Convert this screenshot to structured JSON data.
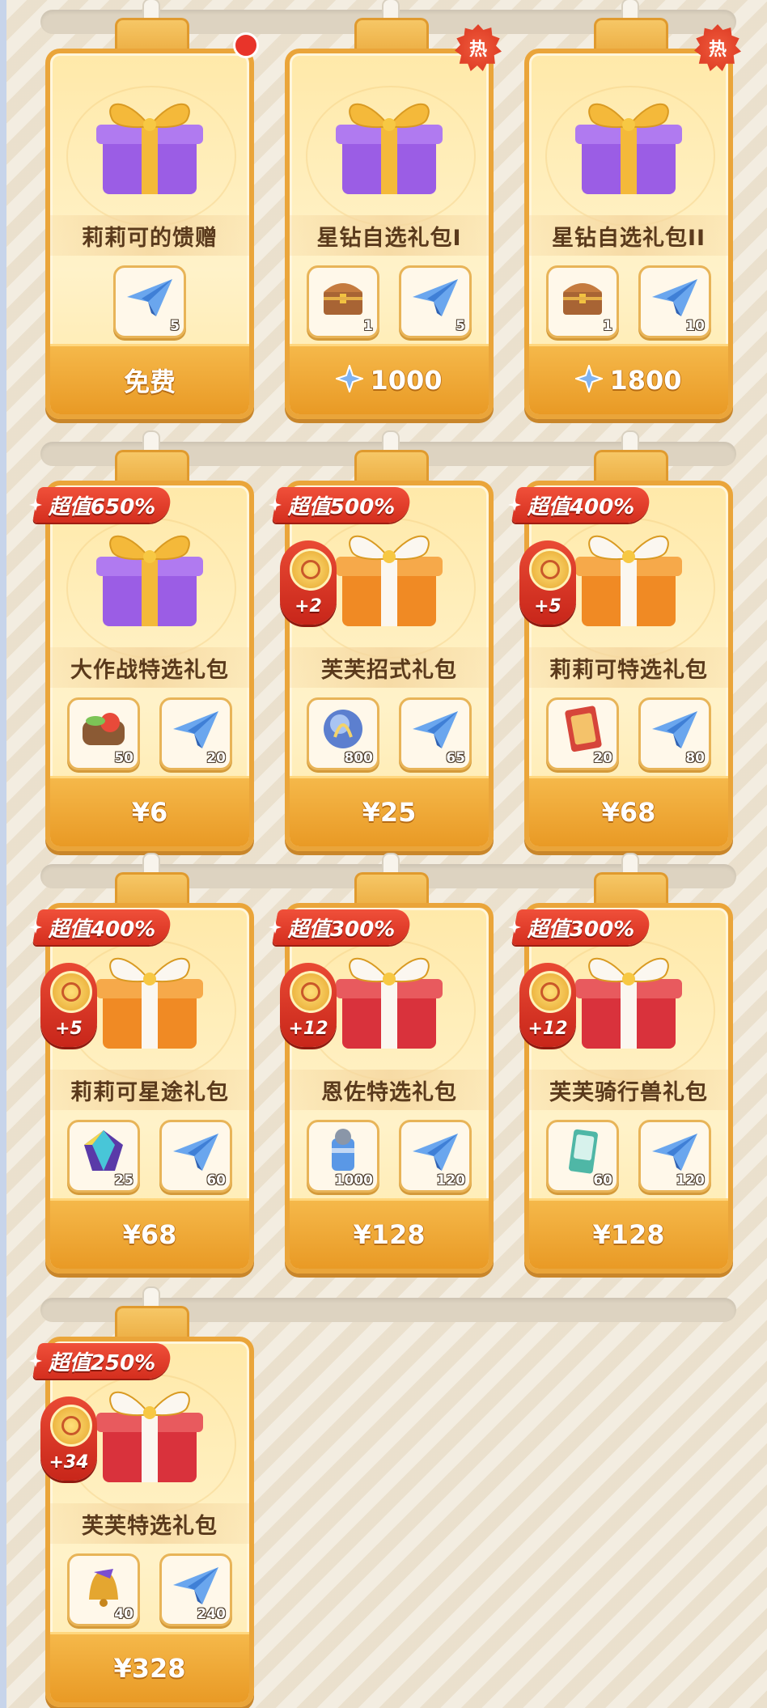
{
  "cards": [
    {
      "title": "莉莉可的馈赠",
      "gift": "purple-gift",
      "price": "免费",
      "currency": "",
      "hot": "",
      "red_dot": true,
      "value": "",
      "bonus": "",
      "items": [
        {
          "icon": "paper-plane-icon",
          "qty": "5"
        }
      ]
    },
    {
      "title": "星钻自选礼包I",
      "gift": "purple-gift",
      "price": "1000",
      "currency": "star-diamond-icon",
      "hot": "热",
      "red_dot": false,
      "value": "",
      "bonus": "",
      "items": [
        {
          "icon": "treasure-chest-icon",
          "qty": "1"
        },
        {
          "icon": "paper-plane-icon",
          "qty": "5"
        }
      ]
    },
    {
      "title": "星钻自选礼包II",
      "gift": "purple-gift",
      "price": "1800",
      "currency": "star-diamond-icon",
      "hot": "热",
      "red_dot": false,
      "value": "",
      "bonus": "",
      "items": [
        {
          "icon": "treasure-chest-icon",
          "qty": "1"
        },
        {
          "icon": "paper-plane-icon",
          "qty": "10"
        }
      ]
    },
    {
      "title": "大作战特选礼包",
      "gift": "purple-gift",
      "price": "¥6",
      "currency": "",
      "hot": "",
      "red_dot": false,
      "value": "超值650%",
      "bonus": "",
      "items": [
        {
          "icon": "food-box-icon",
          "qty": "50"
        },
        {
          "icon": "paper-plane-icon",
          "qty": "20"
        }
      ]
    },
    {
      "title": "芙芙招式礼包",
      "gift": "orange-gift",
      "price": "¥25",
      "currency": "",
      "hot": "",
      "red_dot": false,
      "value": "超值500%",
      "bonus": "+2",
      "items": [
        {
          "icon": "blue-orb-icon",
          "qty": "800"
        },
        {
          "icon": "paper-plane-icon",
          "qty": "65"
        }
      ]
    },
    {
      "title": "莉莉可特选礼包",
      "gift": "orange-gift",
      "price": "¥68",
      "currency": "",
      "hot": "",
      "red_dot": false,
      "value": "超值400%",
      "bonus": "+5",
      "items": [
        {
          "icon": "card-icon",
          "qty": "20"
        },
        {
          "icon": "paper-plane-icon",
          "qty": "80"
        }
      ]
    },
    {
      "title": "莉莉可星途礼包",
      "gift": "orange-gift",
      "price": "¥68",
      "currency": "",
      "hot": "",
      "red_dot": false,
      "value": "超值400%",
      "bonus": "+5",
      "items": [
        {
          "icon": "crystal-icon",
          "qty": "25"
        },
        {
          "icon": "paper-plane-icon",
          "qty": "60"
        }
      ]
    },
    {
      "title": "恩佐特选礼包",
      "gift": "red-gift",
      "price": "¥128",
      "currency": "",
      "hot": "",
      "red_dot": false,
      "value": "超值300%",
      "bonus": "+12",
      "items": [
        {
          "icon": "gear-canister-icon",
          "qty": "1000"
        },
        {
          "icon": "paper-plane-icon",
          "qty": "120"
        }
      ]
    },
    {
      "title": "芙芙骑行兽礼包",
      "gift": "red-gift",
      "price": "¥128",
      "currency": "",
      "hot": "",
      "red_dot": false,
      "value": "超值300%",
      "bonus": "+12",
      "items": [
        {
          "icon": "mount-card-icon",
          "qty": "60"
        },
        {
          "icon": "paper-plane-icon",
          "qty": "120"
        }
      ]
    },
    {
      "title": "芙芙特选礼包",
      "gift": "red-gift",
      "price": "¥328",
      "currency": "",
      "hot": "",
      "red_dot": false,
      "value": "超值250%",
      "bonus": "+34",
      "items": [
        {
          "icon": "bell-icon",
          "qty": "40"
        },
        {
          "icon": "paper-plane-icon",
          "qty": "240"
        }
      ]
    }
  ],
  "colors": {
    "purple_gift": "#9b5de5",
    "orange_gift": "#f08a24",
    "red_gift": "#d9323c",
    "ribbon_gold": "#f4b93a",
    "ribbon_white": "#fbf7f0"
  }
}
